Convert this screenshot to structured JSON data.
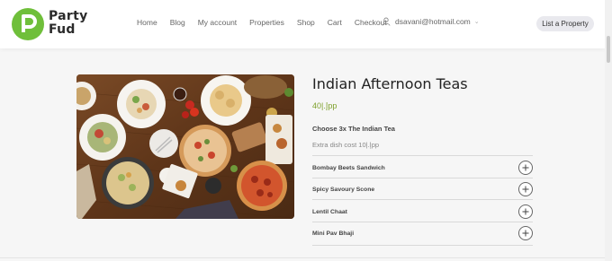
{
  "brand": {
    "name_line1": "Party",
    "name_line2": "Fud",
    "logo_icon": "p-letter-icon",
    "accent": "#6fbf3a"
  },
  "nav": {
    "items": [
      "Home",
      "Blog",
      "My account",
      "Properties",
      "Shop",
      "Cart",
      "Checkout"
    ]
  },
  "user": {
    "email": "dsavani@hotmail.com",
    "icon": "user-icon"
  },
  "header": {
    "list_property_label": "List a Property"
  },
  "product": {
    "title": "Indian Afternoon Teas",
    "price": "40|.إpp",
    "choose_label": "Choose 3x The Indian Tea",
    "extra_label": "Extra dish cost 10|.إpp",
    "options": [
      {
        "label": "Bombay Beets Sandwich"
      },
      {
        "label": "Spicy Savoury Scone"
      },
      {
        "label": "Lentil Chaat"
      },
      {
        "label": "Mini Pav Bhaji"
      }
    ],
    "price_color": "#7ea12c"
  }
}
